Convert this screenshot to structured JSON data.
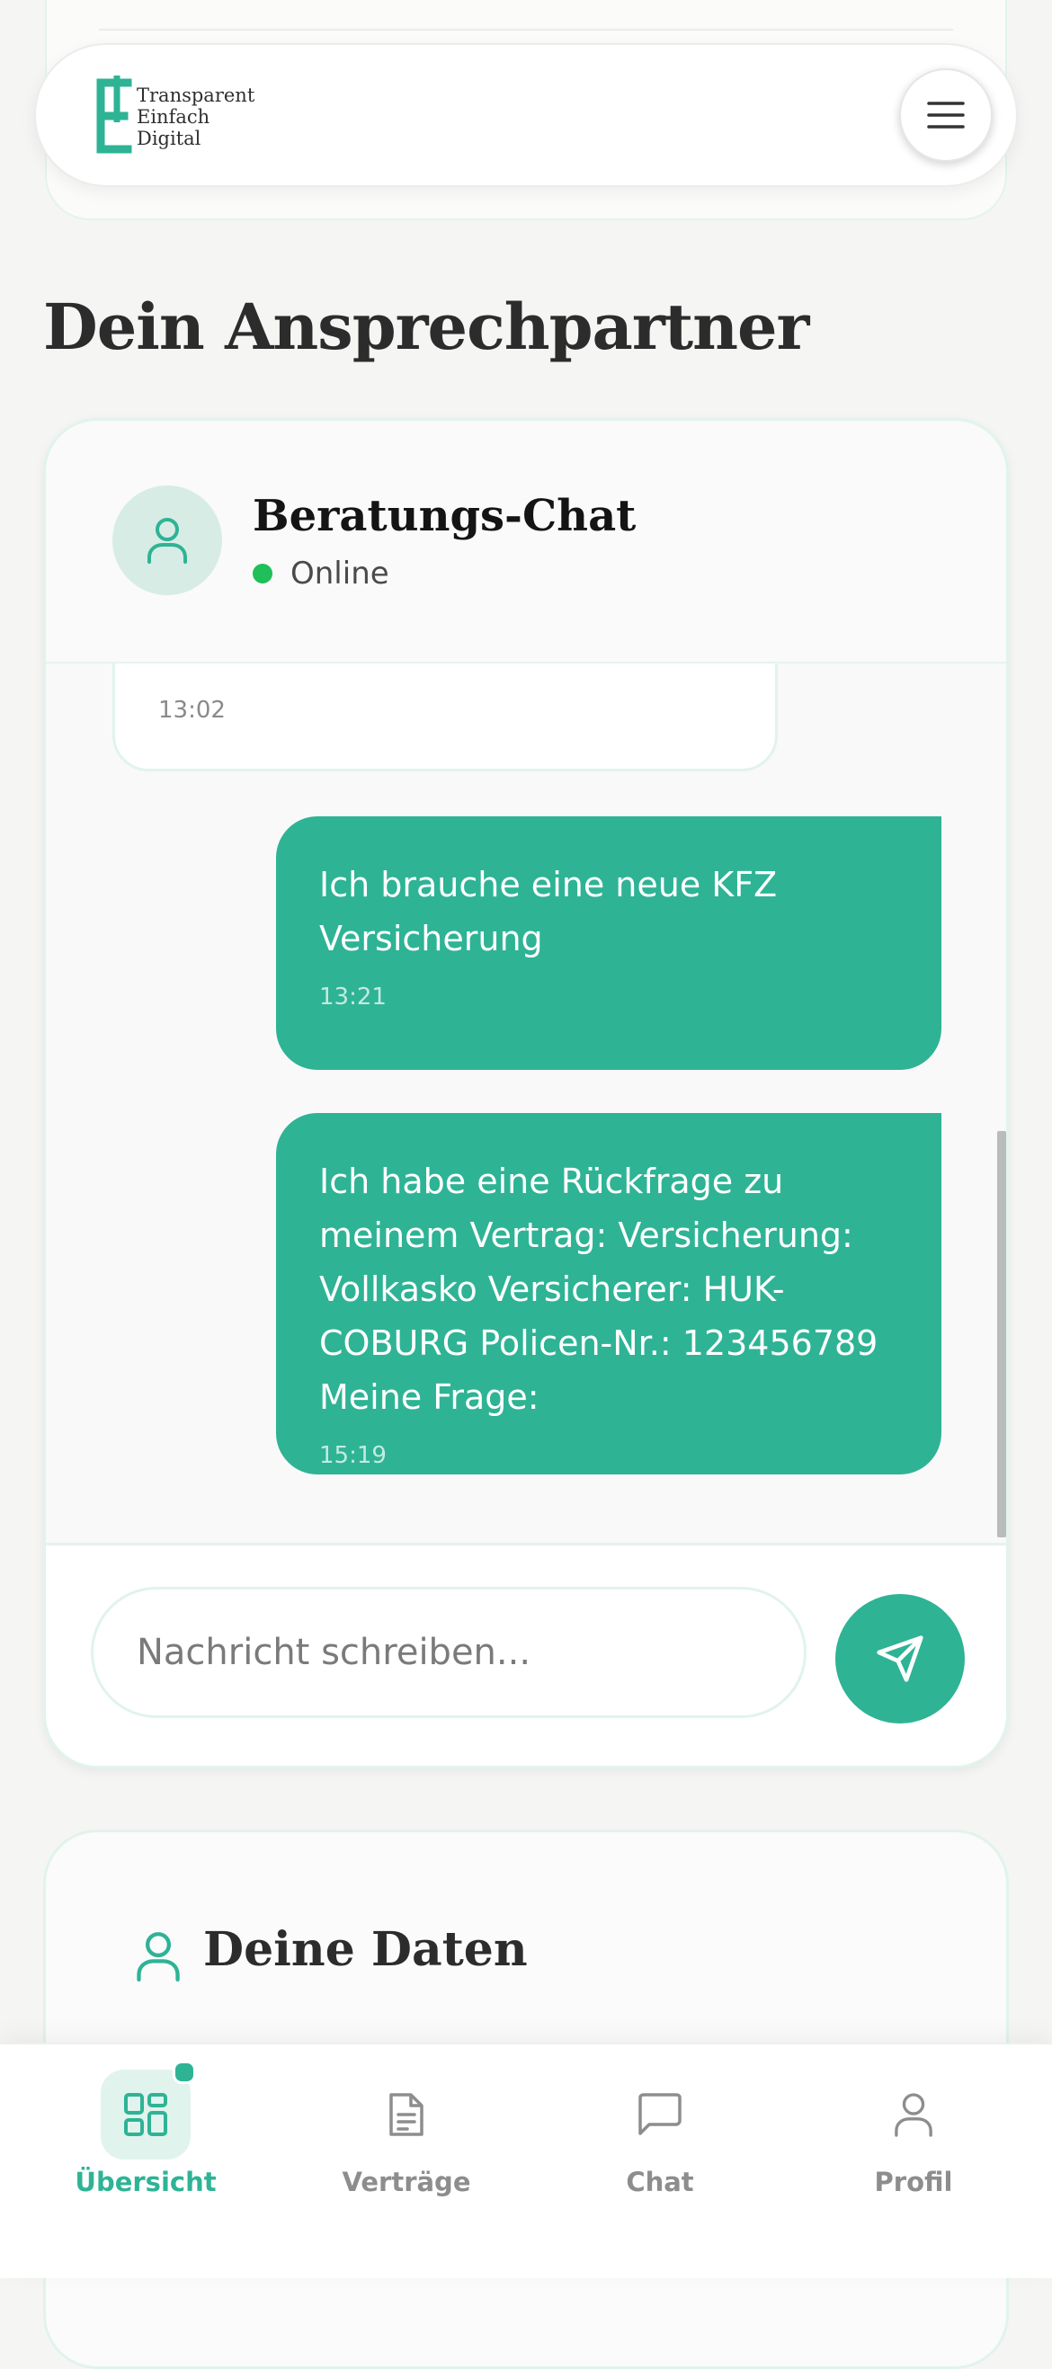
{
  "brand": {
    "tagline": [
      "Transparent",
      "Einfach",
      "Digital"
    ],
    "accent_color": "#2eb395"
  },
  "header": {
    "menu_icon": "hamburger-menu-icon"
  },
  "page": {
    "title": "Dein Ansprechpartner"
  },
  "chat": {
    "title": "Beratungs-Chat",
    "status": "Online",
    "status_color": "#1fbf5a",
    "messages": [
      {
        "direction": "incoming",
        "text": "",
        "time": "13:02"
      },
      {
        "direction": "outgoing",
        "text": "Ich brauche eine neue KFZ Versicherung",
        "time": "13:21"
      },
      {
        "direction": "outgoing",
        "text": "Ich habe eine Rückfrage zu meinem Vertrag: Versicherung: Vollkasko Versicherer: HUK-COBURG Policen-Nr.: 123456789 Meine Frage:",
        "time": "15:19"
      }
    ],
    "input_placeholder": "Nachricht schreiben...",
    "send_icon": "send-icon"
  },
  "data_section": {
    "title": "Deine Daten",
    "icon": "user-icon"
  },
  "bottom_nav": {
    "items": [
      {
        "label": "Übersicht",
        "icon": "dashboard-icon",
        "active": true,
        "badge": true
      },
      {
        "label": "Verträge",
        "icon": "document-icon",
        "active": false
      },
      {
        "label": "Chat",
        "icon": "chat-icon",
        "active": false
      },
      {
        "label": "Profil",
        "icon": "user-icon",
        "active": false
      }
    ]
  }
}
